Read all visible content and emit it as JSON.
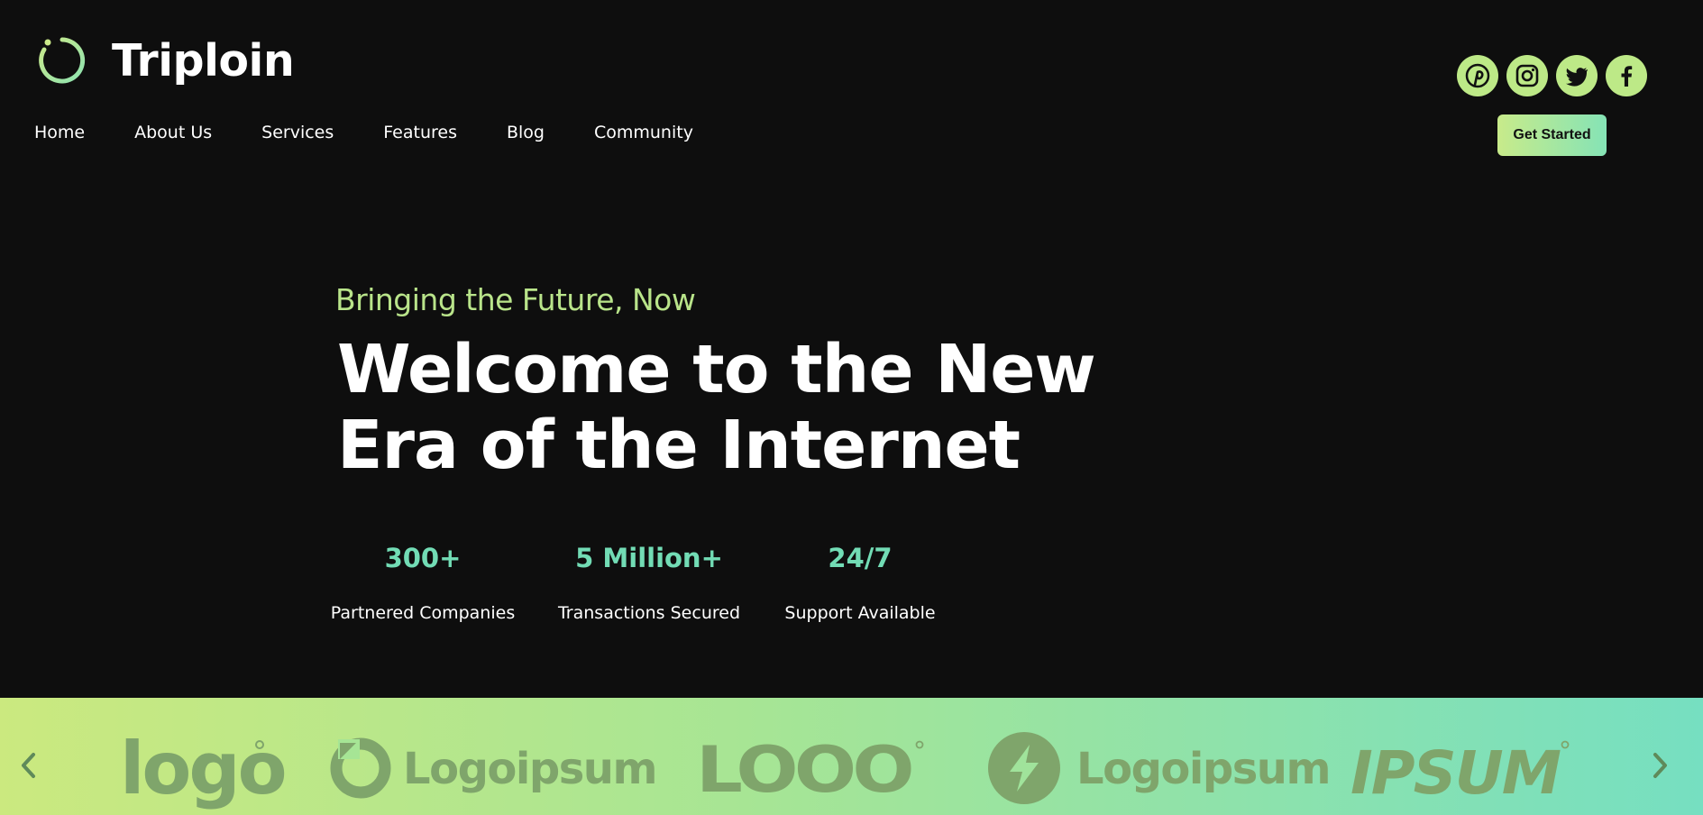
{
  "brand": {
    "name": "Triploin",
    "logo_icon": "ring-logo-icon",
    "accent": "#bde987"
  },
  "nav": {
    "items": [
      "Home",
      "About Us",
      "Services",
      "Features",
      "Blog",
      "Community"
    ]
  },
  "socials": [
    "pinterest-icon",
    "instagram-icon",
    "twitter-icon",
    "facebook-icon"
  ],
  "cta": {
    "label": "Get Started"
  },
  "hero": {
    "tagline": "Bringing the Future, Now",
    "headline_line1": "Welcome to the New",
    "headline_line2": "Era of the Internet"
  },
  "stats": [
    {
      "value": "300+",
      "label": "Partnered Companies"
    },
    {
      "value": "5 Million+",
      "label": "Transactions Secured"
    },
    {
      "value": "24/7",
      "label": "Support Available"
    }
  ],
  "partners": {
    "logos": [
      "logo",
      "Logoipsum",
      "LOOO",
      "Logoipsum",
      "IPSUM"
    ],
    "prev_icon": "chevron-left-icon",
    "next_icon": "chevron-right-icon"
  },
  "colors": {
    "background": "#0e0e0e",
    "stat_value": "#72dcb5",
    "band_start": "#cbe97f",
    "band_end": "#76dfc1"
  }
}
